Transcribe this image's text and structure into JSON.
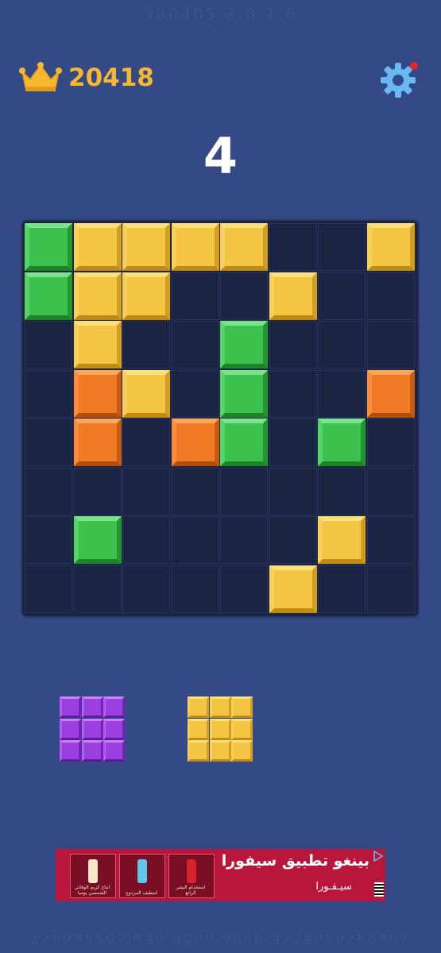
{
  "header": {
    "faint_top": "380405.2.0.1.0",
    "best_score": "20418",
    "crown_icon": "crown-icon",
    "settings_icon": "gear-icon",
    "settings_badge_color": "#e4262a"
  },
  "score": "4",
  "board": {
    "rows": 8,
    "cols": 8,
    "cells": [
      [
        "green",
        "yellow",
        "yellow",
        "yellow",
        "yellow",
        "",
        "",
        "yellow"
      ],
      [
        "green",
        "yellow",
        "yellow",
        "",
        "",
        "yellow",
        "",
        ""
      ],
      [
        "",
        "yellow",
        "",
        "",
        "green",
        "",
        "",
        ""
      ],
      [
        "",
        "orange",
        "yellow",
        "",
        "green",
        "",
        "",
        "orange"
      ],
      [
        "",
        "orange",
        "",
        "orange",
        "green",
        "",
        "green",
        ""
      ],
      [
        "",
        "",
        "",
        "",
        "",
        "",
        "",
        ""
      ],
      [
        "",
        "green",
        "",
        "",
        "",
        "",
        "yellow",
        ""
      ],
      [
        "",
        "",
        "",
        "",
        "",
        "yellow",
        "",
        ""
      ]
    ]
  },
  "colors": {
    "background": "#344a86",
    "board": "#1c2644",
    "yellow": "#f4c542",
    "green": "#3cc14e",
    "orange": "#f07a26",
    "purple": "#9b3fe0",
    "score_gold": "#f7b731"
  },
  "tray": [
    {
      "color": "purple",
      "rows": 3,
      "cols": 3
    },
    {
      "color": "yellow",
      "rows": 3,
      "cols": 3
    }
  ],
  "ad": {
    "headline": "بينغو تطبيق سيفورا",
    "brand": "سيـفـورا",
    "products": [
      {
        "caption": "انتاج كريم الوقائي الشمسي يوميا",
        "color": "#f5e7c8"
      },
      {
        "caption": "لتنظيف المزدوج",
        "color": "#5ec6e8"
      },
      {
        "caption": "استخدام البشر الراتع",
        "color": "#d8232f"
      }
    ],
    "choice_icon": "ad-choices-icon"
  },
  "footer": {
    "faint_bottom": "12898850-0848-4000-9660-4224059268807"
  }
}
